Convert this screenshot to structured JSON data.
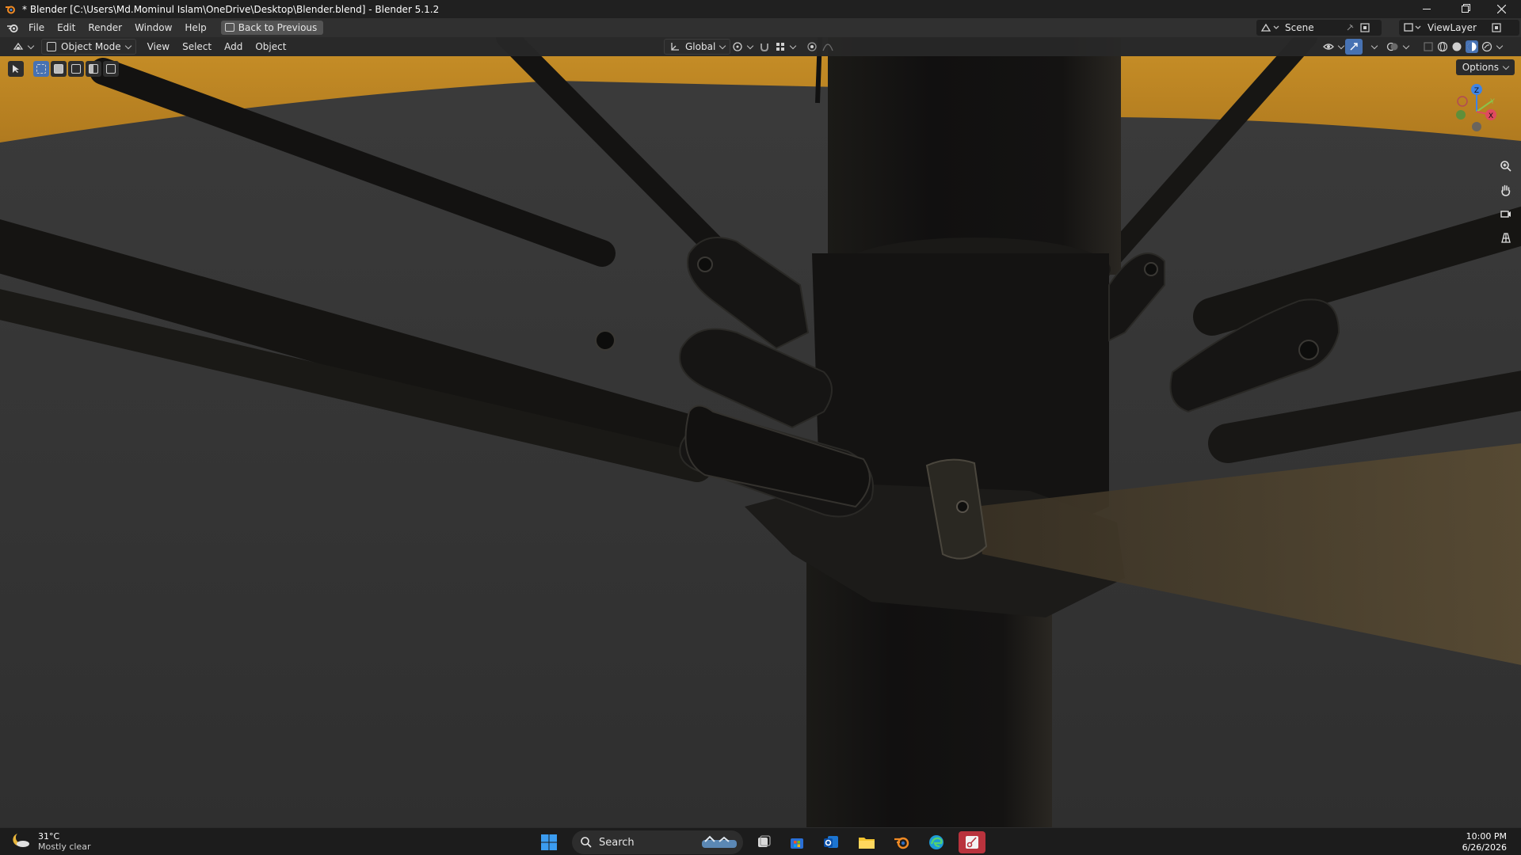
{
  "window": {
    "title": "* Blender [C:\\Users\\Md.Mominul Islam\\OneDrive\\Desktop\\Blender.blend] - Blender 5.1.2",
    "controls": [
      "minimize",
      "restore",
      "close"
    ]
  },
  "menubar": {
    "items": [
      "File",
      "Edit",
      "Render",
      "Window",
      "Help"
    ],
    "back_button": "Back to Previous",
    "scene_label": "Scene",
    "viewlayer_label": "ViewLayer"
  },
  "viewport_header": {
    "mode": "Object Mode",
    "menus": [
      "View",
      "Select",
      "Add",
      "Object"
    ],
    "transform_orientation": "Global",
    "options_label": "Options"
  },
  "gizmo": {
    "axes": {
      "z": "Z",
      "y": "Y",
      "x": "X"
    },
    "colors": {
      "x": "#e04a5f",
      "y": "#8bc34a",
      "z": "#3f84e5"
    }
  },
  "taskbar": {
    "weather_temp": "31°C",
    "weather_condition": "Mostly clear",
    "search_label": "Search",
    "time": "10:00 PM",
    "date": "6/26/2026"
  },
  "colors": {
    "canopy": "#c48c26",
    "accent": "#4772b3",
    "floor": "#3a3a3a"
  }
}
